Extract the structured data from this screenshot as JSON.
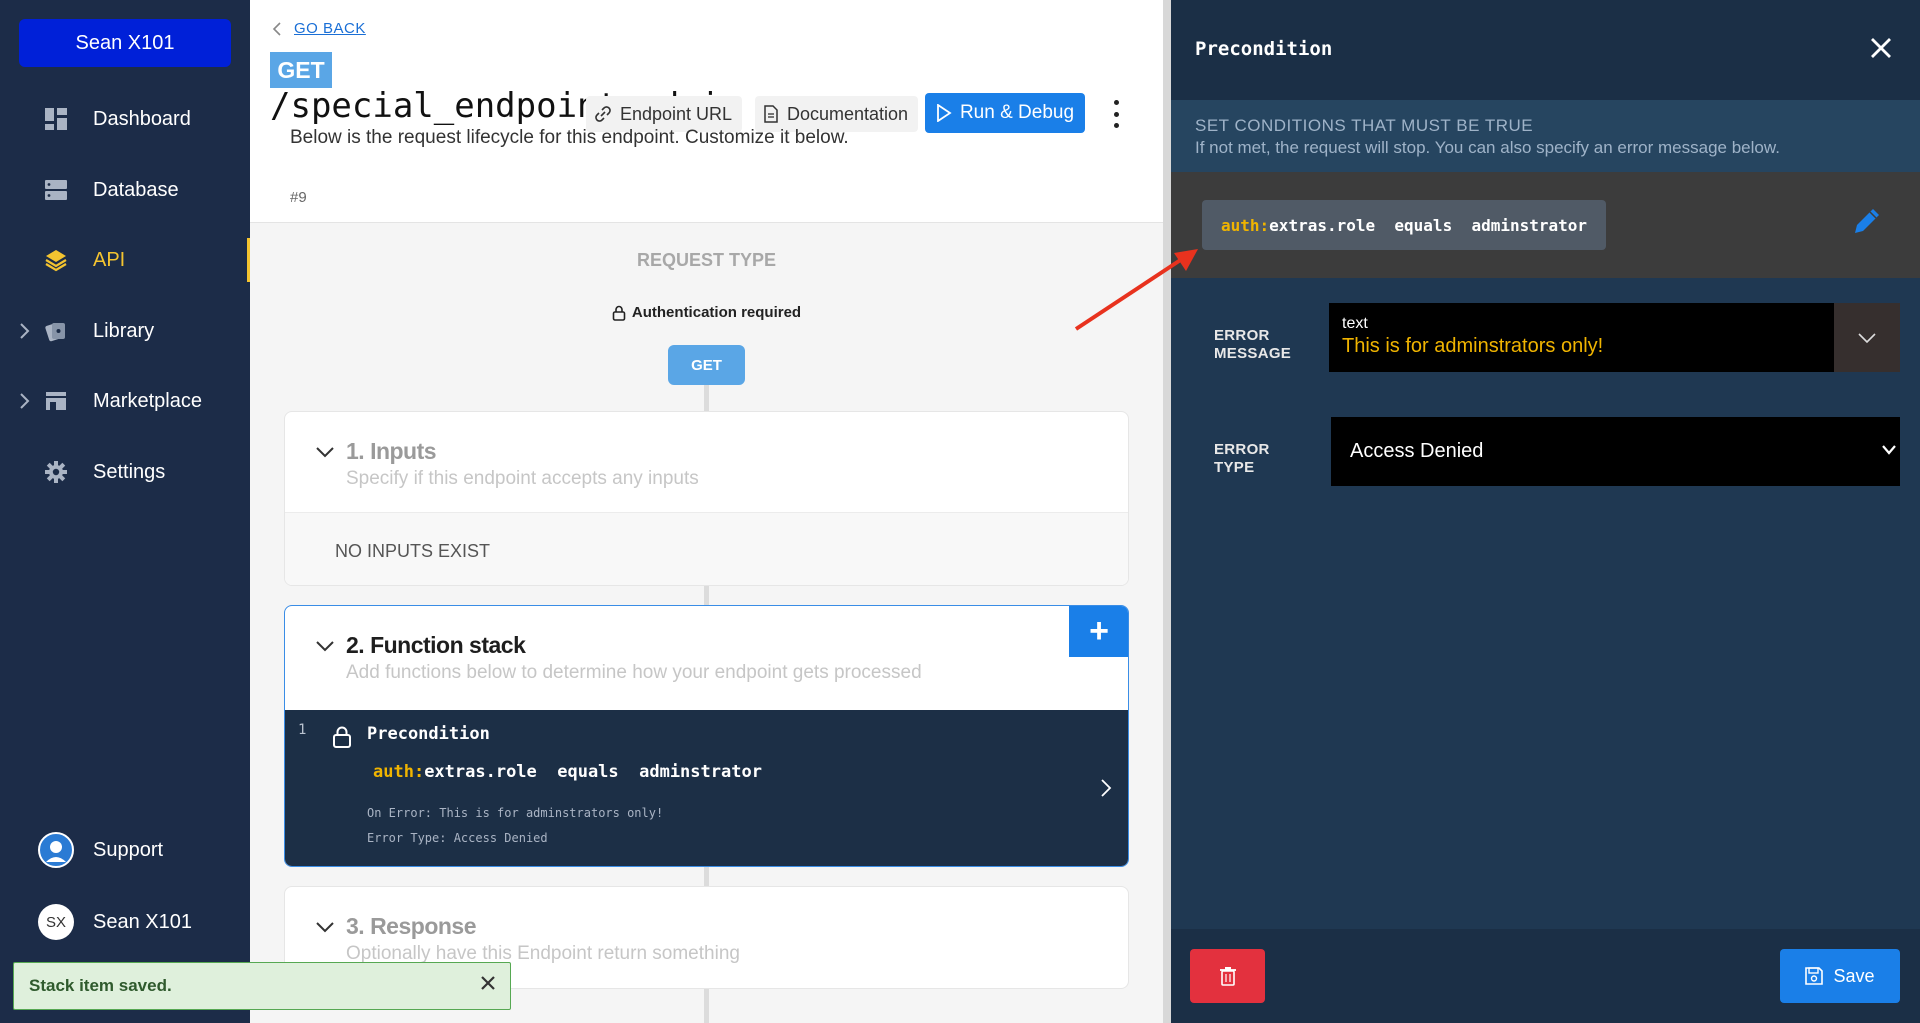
{
  "sidebar": {
    "workspace": "Sean X101",
    "items": [
      {
        "label": "Dashboard",
        "icon": "dashboard-icon"
      },
      {
        "label": "Database",
        "icon": "database-icon"
      },
      {
        "label": "API",
        "icon": "api-icon",
        "active": true
      },
      {
        "label": "Library",
        "icon": "library-icon",
        "expandable": true
      },
      {
        "label": "Marketplace",
        "icon": "marketplace-icon",
        "expandable": true
      },
      {
        "label": "Settings",
        "icon": "gear-icon"
      }
    ],
    "support_label": "Support",
    "user_name": "Sean X101",
    "user_initials": "SX"
  },
  "header": {
    "go_back": "GO BACK",
    "method": "GET",
    "path": "/special_endpoint_admin",
    "endpoint_url_label": "Endpoint URL",
    "documentation_label": "Documentation",
    "run_debug_label": "Run & Debug",
    "description": "Below is the request lifecycle for this endpoint. Customize it below.",
    "id": "#9"
  },
  "flow": {
    "request_type_title": "REQUEST TYPE",
    "auth_required": "Authentication required",
    "method_pill": "GET",
    "inputs": {
      "title": "1. Inputs",
      "subtitle": "Specify if this endpoint accepts any inputs",
      "empty": "NO INPUTS EXIST"
    },
    "function_stack": {
      "title": "2. Function stack",
      "subtitle": "Add functions below to determine how your endpoint gets processed",
      "add_label": "+",
      "item": {
        "index": "1",
        "name": "Precondition",
        "cond_prefix": "auth:",
        "cond_rest": "extras.role  equals  adminstrator",
        "on_error": "On Error: This is for adminstrators only!",
        "error_type": "Error Type: Access Denied"
      }
    },
    "response": {
      "title": "3. Response",
      "subtitle": "Optionally have this Endpoint return something"
    }
  },
  "panel": {
    "title": "Precondition",
    "section_title": "SET CONDITIONS THAT MUST BE TRUE",
    "section_sub": "If not met, the request will stop. You can also specify an error message below.",
    "cond_prefix": "auth:",
    "cond_rest": "extras.role  equals  adminstrator",
    "error_message_label_1": "ERROR",
    "error_message_label_2": "MESSAGE",
    "error_message_type": "text",
    "error_message_value": "This is for adminstrators only!",
    "error_type_label_1": "ERROR",
    "error_type_label_2": "TYPE",
    "error_type_value": "Access Denied",
    "save_label": "Save"
  },
  "toast": {
    "message": "Stack item saved."
  },
  "colors": {
    "sidebar_bg": "#1c2c48",
    "accent": "#1a7fe8",
    "active": "#f4c430",
    "danger": "#e3313e",
    "panel_bg": "#1f3852"
  }
}
